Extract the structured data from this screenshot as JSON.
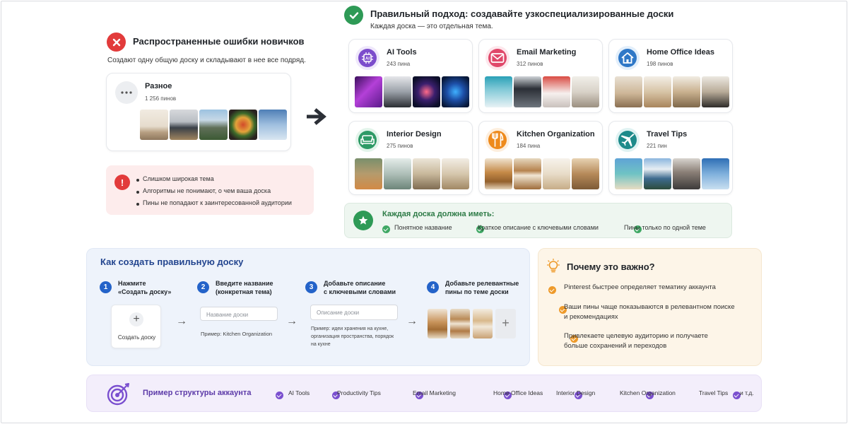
{
  "mistakes": {
    "title": "Распространенные ошибки новичков",
    "subtitle": "Создают одну общую доску и складывают в нее все подряд.",
    "board": {
      "name": "Разное",
      "count": "1 256 пинов"
    },
    "problems": [
      "Слишком широкая тема",
      "Алгоритмы не понимают, о чем ваша доска",
      "Пины не попадают к заинтересованной аудитории"
    ]
  },
  "right": {
    "title": "Правильный подход: создавайте узкоспециализированные доски",
    "subtitle": "Каждая доска — это отдельная тема.",
    "boards": [
      {
        "name": "AI Tools",
        "count": "243 пина",
        "icon": "chip-icon",
        "color": "#7c4dcc",
        "bg": "#efe8fb"
      },
      {
        "name": "Email Marketing",
        "count": "312 пинов",
        "icon": "envelope-icon",
        "color": "#e0486a",
        "bg": "#fde7ec"
      },
      {
        "name": "Home Office Ideas",
        "count": "198 пинов",
        "icon": "home-icon",
        "color": "#2f78c7",
        "bg": "#e3effb"
      },
      {
        "name": "Interior Design",
        "count": "275 пинов",
        "icon": "sofa-icon",
        "color": "#2e9a66",
        "bg": "#e2f4ea"
      },
      {
        "name": "Kitchen Organization",
        "count": "184 пина",
        "icon": "fork-knife-icon",
        "color": "#ee8a1c",
        "bg": "#fdeedd"
      },
      {
        "name": "Travel Tips",
        "count": "221 пин",
        "icon": "plane-icon",
        "color": "#1d8a8a",
        "bg": "#dff2f2"
      }
    ],
    "must_title": "Каждая доска должна иметь:",
    "must_items": [
      "Понятное название",
      "Краткое описание с ключевыми словами",
      "Пины только по одной теме"
    ]
  },
  "howto": {
    "title": "Как создать правильную доску",
    "steps": [
      {
        "num": "1",
        "line1": "Нажмите",
        "line2": "«Создать доску»"
      },
      {
        "num": "2",
        "line1": "Введите название",
        "line2": "(конкретная тема)"
      },
      {
        "num": "3",
        "line1": "Добавьте описание",
        "line2": "с ключевыми словами"
      },
      {
        "num": "4",
        "line1": "Добавьте релевантные",
        "line2": "пины по теме доски"
      }
    ],
    "create_label": "Создать доску",
    "name_placeholder": "Название доски",
    "name_example": "Пример: Kitchen Organization",
    "desc_placeholder": "Описание доски",
    "desc_example": [
      "Пример: идеи хранения на кухне,",
      "организация пространства, порядок",
      "на кухне"
    ]
  },
  "why": {
    "title": "Почему это важно?",
    "items": [
      [
        "Pinterest быстрее определяет тематику аккаунта"
      ],
      [
        "Ваши пины чаще показываются в релевантном поиске",
        "и рекомендациях"
      ],
      [
        "Привлекаете целевую аудиторию и получаете",
        "больше сохранений и переходов"
      ]
    ]
  },
  "structure": {
    "title": "Пример структуры аккаунта",
    "items": [
      "AI Tools",
      "Productivity Tips",
      "Email Marketing",
      "Home Office Ideas",
      "Interior Design",
      "Kitchen Organization",
      "Travel Tips"
    ],
    "etc": "и т.д."
  },
  "colors": {
    "green": "#2e9a56",
    "red": "#e23b3b",
    "blue": "#2463c9",
    "orange": "#ee9a2a",
    "purple": "#7a4fcf"
  }
}
